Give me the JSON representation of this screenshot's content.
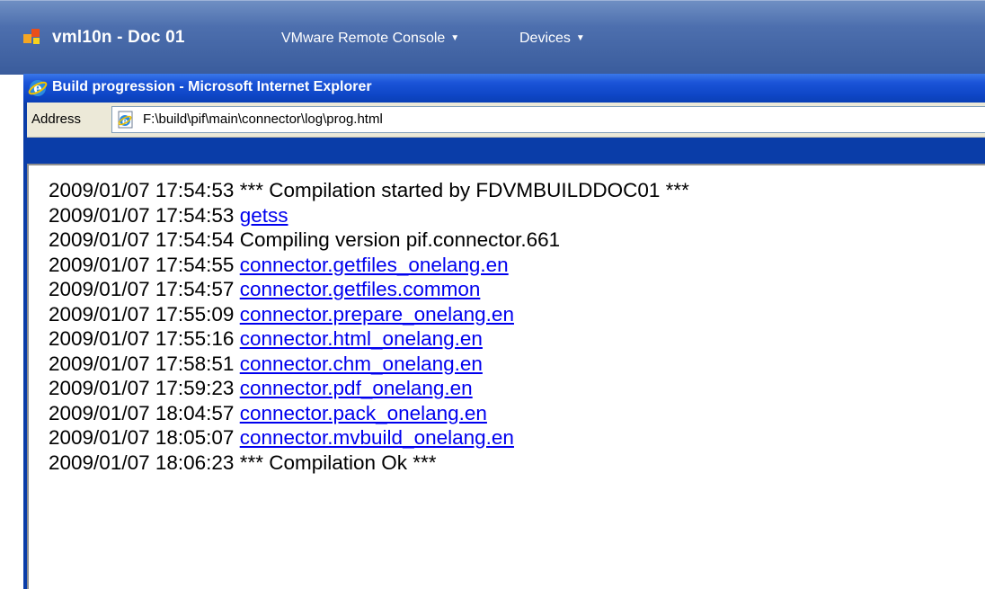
{
  "vmware": {
    "vm_name": "vml10n - Doc 01",
    "menus": [
      {
        "label": "VMware Remote Console"
      },
      {
        "label": "Devices"
      }
    ]
  },
  "browser": {
    "title": "Build progression - Microsoft Internet Explorer",
    "address_label": "Address",
    "address_value": "F:\\build\\pif\\main\\connector\\log\\prog.html"
  },
  "log": [
    {
      "time": "2009/01/07 17:54:53",
      "text": "*** Compilation started by FDVMBUILDDOC01 ***",
      "link": false
    },
    {
      "time": "2009/01/07 17:54:53",
      "text": "getss",
      "link": true
    },
    {
      "time": "2009/01/07 17:54:54",
      "text": "Compiling version pif.connector.661",
      "link": false
    },
    {
      "time": "2009/01/07 17:54:55",
      "text": "connector.getfiles_onelang.en",
      "link": true
    },
    {
      "time": "2009/01/07 17:54:57",
      "text": "connector.getfiles.common",
      "link": true
    },
    {
      "time": "2009/01/07 17:55:09",
      "text": "connector.prepare_onelang.en",
      "link": true
    },
    {
      "time": "2009/01/07 17:55:16",
      "text": "connector.html_onelang.en",
      "link": true
    },
    {
      "time": "2009/01/07 17:58:51",
      "text": "connector.chm_onelang.en",
      "link": true
    },
    {
      "time": "2009/01/07 17:59:23",
      "text": "connector.pdf_onelang.en",
      "link": true
    },
    {
      "time": "2009/01/07 18:04:57",
      "text": "connector.pack_onelang.en",
      "link": true
    },
    {
      "time": "2009/01/07 18:05:07",
      "text": "connector.mvbuild_onelang.en",
      "link": true
    },
    {
      "time": "2009/01/07 18:06:23",
      "text": "*** Compilation Ok ***",
      "link": false
    }
  ],
  "colors": {
    "link": "#0000ee",
    "xp_title_blue": "#0f47c8",
    "vmware_bar": "#4d6fae"
  },
  "icons": {
    "vm_icon": "vmware-logo-icon",
    "ie_icon": "internet-explorer-icon",
    "page_icon": "ie-page-icon",
    "menu_arrow": "chevron-down-icon"
  }
}
